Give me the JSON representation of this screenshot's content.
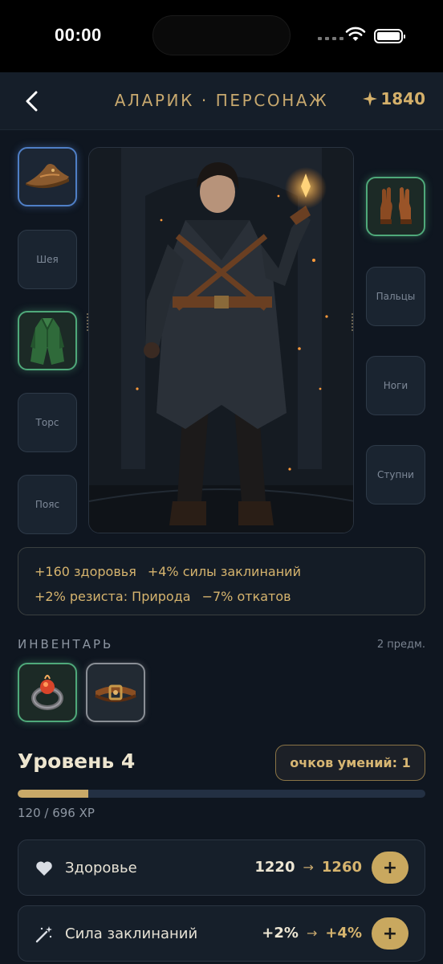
{
  "status_bar": {
    "time": "00:00"
  },
  "nav": {
    "title": "АЛАРИК · ПЕРСОНАЖ",
    "currency_value": "1840",
    "currency_icon": "sparkle-icon"
  },
  "slots_left": [
    {
      "label": "",
      "item": "hat",
      "rarity": "blue"
    },
    {
      "label": "Шея"
    },
    {
      "label": "",
      "item": "robe",
      "rarity": "green"
    },
    {
      "label": "Торс"
    },
    {
      "label": "Пояс"
    }
  ],
  "slots_right": [
    {
      "label": "",
      "item": "gloves",
      "rarity": "green"
    },
    {
      "label": "Пальцы"
    },
    {
      "label": "Ноги"
    },
    {
      "label": "Ступни"
    }
  ],
  "bonuses": {
    "line1": [
      "+160 здоровья",
      "+4% силы заклинаний"
    ],
    "line2": [
      "+2% резиста: Природа",
      "−7% откатов"
    ]
  },
  "inventory": {
    "title": "ИНВЕНТАРЬ",
    "count": "2 предм.",
    "items": [
      {
        "item": "ring",
        "rarity": "green"
      },
      {
        "item": "belt",
        "rarity": "gray"
      }
    ]
  },
  "level": {
    "title": "Уровень 4",
    "skill_points": "очков умений: 1",
    "xp_current": 120,
    "xp_max": 696,
    "xp_text": "120 / 696 XP"
  },
  "stats": [
    {
      "label": "Здоровье",
      "current": "1220",
      "arrow": "→",
      "next": "1260",
      "icon": "heart-icon",
      "button": "+"
    },
    {
      "label": "Сила заклинаний",
      "current": "+2%",
      "arrow": "→",
      "next": "+4%",
      "icon": "magic-wand-icon",
      "button": "+"
    }
  ],
  "colors": {
    "accent": "#c9a85f",
    "background": "#0f1620",
    "rare": "#4f7fc6",
    "uncommon": "#4fa97a"
  }
}
